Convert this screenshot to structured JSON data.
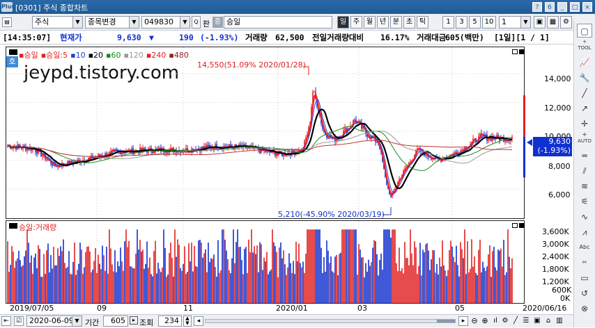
{
  "window": {
    "title": "[0301] 주식 종합차트",
    "logo": "Plus",
    "buttons": [
      "?",
      "6",
      "_",
      "□",
      "×"
    ]
  },
  "toolbar": {
    "market": "주식",
    "mode": "종목변경",
    "code": "049830",
    "pan_label": "판",
    "name_tag": "증",
    "name": "승일",
    "periods": [
      "일",
      "주",
      "월",
      "년",
      "분",
      "초",
      "틱"
    ],
    "selected_period": "일",
    "n1": "1",
    "n3": "3",
    "n5": "5",
    "n10": "10",
    "interval": "1"
  },
  "info": {
    "time": "[14:35:07]",
    "price_label": "현재가",
    "price": "9,630",
    "change_arrow": "▼",
    "change": "190",
    "change_pct": "(-1.93%)",
    "vol_label": "거래량",
    "volume": "62,500",
    "prev_vol_label": "전일거래량대비",
    "prev_vol_ratio": "16.17%",
    "amount_label": "거래대금",
    "amount": "605(백만)",
    "period_page": "[1일][1 / 1]"
  },
  "price_panel": {
    "legend": [
      {
        "t": "승일",
        "c": "#e02020"
      },
      {
        "t": "승일:5",
        "c": "#e02020"
      },
      {
        "t": "10",
        "c": "#2040d0"
      },
      {
        "t": "20",
        "c": "#000000"
      },
      {
        "t": "60",
        "c": "#1a8a1a"
      },
      {
        "t": "120",
        "c": "#999999"
      },
      {
        "t": "240",
        "c": "#e02020"
      },
      {
        "t": "480",
        "c": "#8b2020"
      }
    ],
    "badge": "호",
    "watermark": "jeypd.tistory.com",
    "high_label": "14,550(51.09% 2020/01/28)",
    "low_label": "5,210(-45.90% 2020/03/19)",
    "y_ticks": [
      "14,000",
      "12,000",
      "10,000",
      "8,000",
      "6,000"
    ],
    "cur_price": "9,630",
    "cur_pct": "(-1.93%)"
  },
  "volume_panel": {
    "legend": "승일:거래량",
    "y_ticks": [
      "3,600K",
      "3,000K",
      "2,400K",
      "1,800K",
      "1,200K",
      "600K",
      "0K"
    ]
  },
  "x_axis": [
    "2019/07/05",
    "09",
    "11",
    "2020/01",
    "03",
    "05",
    "2020/06/16"
  ],
  "bottom": {
    "date": "2020-06-09",
    "period_label": "기간",
    "period": "605",
    "query_label": "조회",
    "count": "234"
  },
  "colors": {
    "up": "#e02020",
    "down": "#1030d0",
    "ma10": "#2040d0",
    "ma20": "#000000",
    "ma60": "#1a8a1a",
    "ma120": "#999999",
    "ma240": "#c03030"
  }
}
